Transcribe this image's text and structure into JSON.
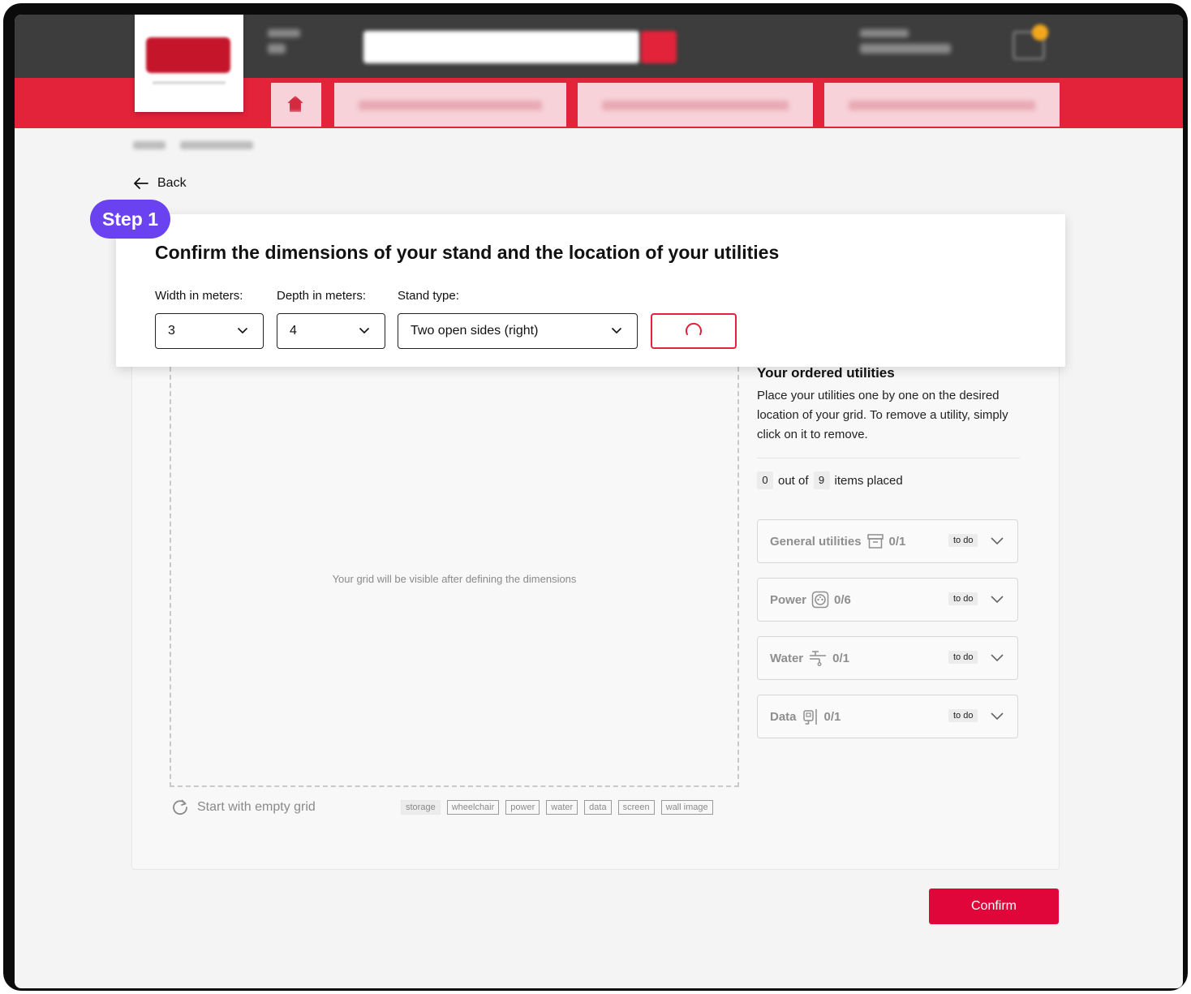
{
  "nav": {
    "back_label": "Back"
  },
  "step": {
    "pill": "Step 1",
    "title": "Confirm the dimensions of your stand and the location of your utilities",
    "width_label": "Width in meters:",
    "width_value": "3",
    "depth_label": "Depth in meters:",
    "depth_value": "4",
    "type_label": "Stand type:",
    "type_value": "Two open sides (right)"
  },
  "grid": {
    "empty_message": "Your grid will be visible after defining the dimensions",
    "reset_label": "Start with empty grid",
    "legend": [
      "storage",
      "wheelchair",
      "power",
      "water",
      "data",
      "screen",
      "wall image"
    ]
  },
  "utilities": {
    "title": "Your ordered utilities",
    "description": "Place your utilities one by one on the desired location of your grid. To remove a utility, simply click on it to remove.",
    "placed": "0",
    "out_of_label": "out of",
    "total": "9",
    "items_placed_label": "items placed",
    "groups": [
      {
        "label": "General utilities",
        "icon": "archive-box-icon",
        "count": "0/1",
        "status": "to do"
      },
      {
        "label": "Power",
        "icon": "power-socket-icon",
        "count": "0/6",
        "status": "to do"
      },
      {
        "label": "Water",
        "icon": "water-tap-icon",
        "count": "0/1",
        "status": "to do"
      },
      {
        "label": "Data",
        "icon": "data-plug-icon",
        "count": "0/1",
        "status": "to do"
      }
    ]
  },
  "actions": {
    "confirm_label": "Confirm"
  },
  "colors": {
    "brand_red": "#e2233a",
    "step_purple": "#6a42f0",
    "header_dark": "#3d3d3d"
  }
}
